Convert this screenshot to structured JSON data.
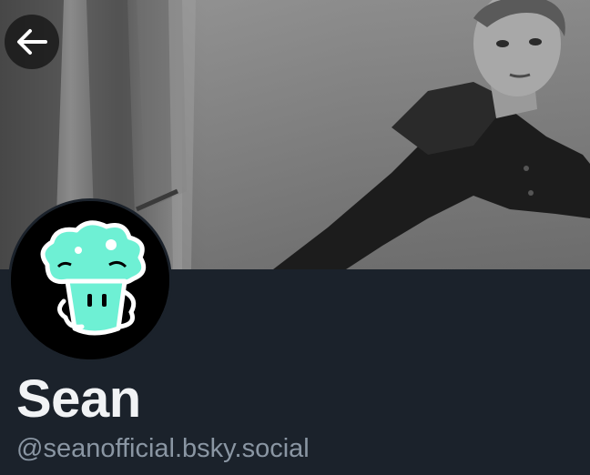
{
  "profile": {
    "display_name": "Sean",
    "handle": "@seanofficial.bsky.social"
  },
  "icons": {
    "back": "arrow-left-icon",
    "avatar": "cartoon-cupcake-avatar"
  },
  "colors": {
    "panel_bg": "#1b222b",
    "name_text": "#f1f3f5",
    "handle_text": "#8a96a3",
    "avatar_accent": "#6ef0d4"
  }
}
